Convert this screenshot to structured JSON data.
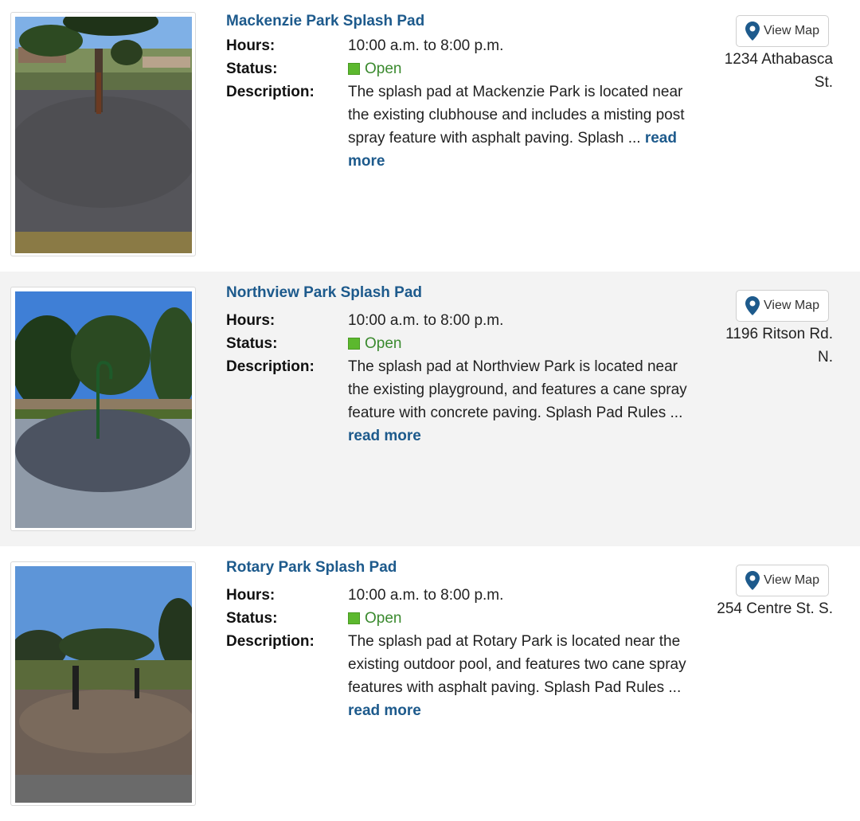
{
  "listings": [
    {
      "title": "Mackenzie Park Splash Pad",
      "hours_label": "Hours:",
      "hours": "10:00 a.m. to 8:00 p.m.",
      "status_label": "Status:",
      "status": "Open",
      "description_label": "Description:",
      "description": "The splash pad at Mackenzie Park is located near the existing clubhouse and includes a misting post spray feature with asphalt paving. Splash ...",
      "read_more": "read more",
      "map_button": "View Map",
      "address_line1": "1234 Athabasca",
      "address_line2": "St.",
      "photo_icon": "splash-pad-photo"
    },
    {
      "title": "Northview Park Splash Pad",
      "hours_label": "Hours:",
      "hours": "10:00 a.m. to 8:00 p.m.",
      "status_label": "Status:",
      "status": "Open",
      "description_label": "Description:",
      "description": "The splash pad at Northview Park is located near the existing playground, and features a cane spray feature with concrete paving. Splash Pad Rules ...",
      "read_more": "read more",
      "map_button": "View Map",
      "address_line1": "1196 Ritson Rd.",
      "address_line2": "N.",
      "photo_icon": "splash-pad-photo"
    },
    {
      "title": "Rotary Park Splash Pad",
      "hours_label": "Hours:",
      "hours": "10:00 a.m. to 8:00 p.m.",
      "status_label": "Status:",
      "status": "Open",
      "description_label": "Description:",
      "description": "The splash pad at Rotary Park is located near the existing outdoor pool, and features two cane spray features with asphalt paving. Splash Pad Rules ...",
      "read_more": "read more",
      "map_button": "View Map",
      "address_line1": "254 Centre St. S.",
      "address_line2": "",
      "photo_icon": "splash-pad-photo"
    }
  ],
  "colors": {
    "link": "#1d5a8c",
    "status_open": "#3b8a2f",
    "status_swatch": "#5cb82e",
    "alt_row_bg": "#f3f3f3"
  }
}
